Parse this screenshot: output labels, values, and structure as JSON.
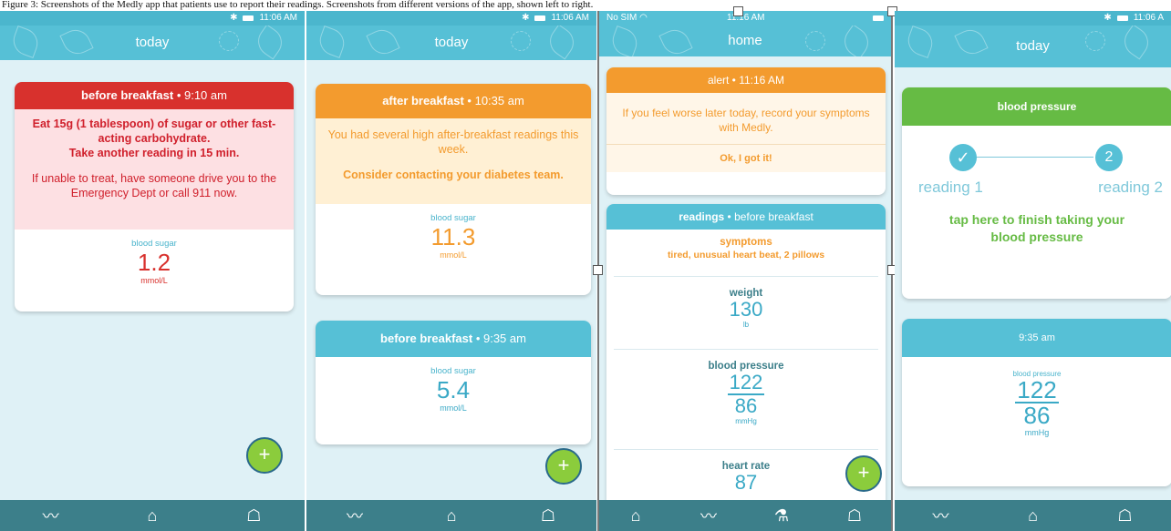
{
  "caption": "Figure 3: Screenshots of the Medly app that patients use to report their readings. Screenshots from different versions of the app, shown left to right.",
  "status": {
    "time_s1": "11:06 AM",
    "time_s2": "11:06 AM",
    "sim_s3": "No SIM",
    "time_s3": "11:16 AM",
    "time_s4": "11:06 A"
  },
  "screens": {
    "s1": {
      "title": "today",
      "card": {
        "head_title": "before breakfast",
        "head_time": " • 9:10 am",
        "msg_bold": "Eat 15g (1 tablespoon) of sugar or other fast-acting carbohydrate.",
        "msg_bold2": "Take another reading in 15 min.",
        "msg_normal": "If unable to treat, have someone drive you to the Emergency Dept or call 911 now.",
        "label": "blood sugar",
        "value": "1.2",
        "unit": "mmol/L"
      },
      "fab": "+"
    },
    "s2": {
      "title": "today",
      "card1": {
        "head_title": "after breakfast",
        "head_time": " • 10:35 am",
        "msg": "You had several high after-breakfast readings this week.",
        "msg_bold": "Consider contacting your diabetes team.",
        "label": "blood sugar",
        "value": "11.3",
        "unit": "mmol/L"
      },
      "card2": {
        "head_title": "before breakfast",
        "head_time": " • 9:35 am",
        "label": "blood sugar",
        "value": "5.4",
        "unit": "mmol/L"
      },
      "fab": "+"
    },
    "s3": {
      "title": "home",
      "alert": {
        "head": "alert • 11:16 AM",
        "msg": "If you feel worse later today, record your symptoms with Medly.",
        "button": "Ok, I got it!"
      },
      "readings": {
        "head_title": "readings",
        "head_sub": " • before breakfast",
        "symptoms_label": "symptoms",
        "symptoms_value": "tired, unusual heart beat, 2 pillows",
        "weight_label": "weight",
        "weight_value": "130",
        "weight_unit": "lb",
        "bp_label": "blood pressure",
        "bp_sys": "122",
        "bp_dia": "86",
        "bp_unit": "mmHg",
        "hr_label": "heart rate",
        "hr_value": "87"
      },
      "fab": "+"
    },
    "s4": {
      "title": "today",
      "card1": {
        "head": "blood pressure",
        "step1_label": "reading 1",
        "step2_num": "2",
        "step2_label": "reading 2",
        "cta": "tap here to finish taking your blood pressure"
      },
      "card2": {
        "head": "9:35 am",
        "label": "blood pressure",
        "sys": "122",
        "dia": "86",
        "unit": "mmHg"
      }
    }
  },
  "colors": {
    "teal": "#56c0d6",
    "red": "#d8312d",
    "orange": "#f39b2e",
    "green": "#66bb44",
    "navbar": "#3c7f8a"
  }
}
